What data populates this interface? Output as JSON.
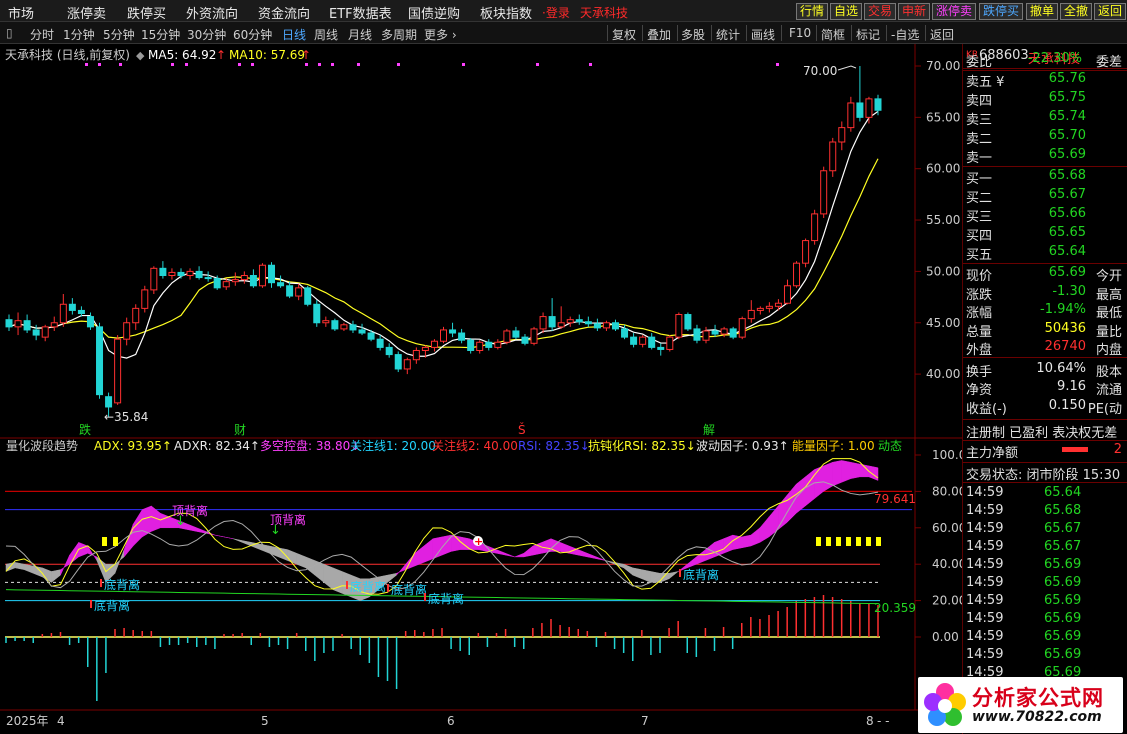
{
  "menu": {
    "items": [
      "市场",
      "涨停卖",
      "跌停买",
      "外资流向",
      "资金流向",
      "ETF数据表",
      "国债逆购",
      "板块指数"
    ],
    "login": "登录",
    "stock_name": "天承科技"
  },
  "right_buttons": [
    {
      "label": "行情",
      "color": "#ffff22"
    },
    {
      "label": "自选",
      "color": "#ffff22"
    },
    {
      "label": "交易",
      "color": "#ff3030"
    },
    {
      "label": "申新",
      "color": "#ff3030"
    },
    {
      "label": "涨停卖",
      "color": "#ff40ff"
    },
    {
      "label": "跌停买",
      "color": "#4ea8ff"
    },
    {
      "label": "撤单",
      "color": "#ffff22"
    },
    {
      "label": "全撤",
      "color": "#ffff22"
    },
    {
      "label": "返回",
      "color": "#ffff22"
    }
  ],
  "toolbar": {
    "periods": [
      "分时",
      "1分钟",
      "5分钟",
      "15分钟",
      "30分钟",
      "60分钟",
      "日线",
      "周线",
      "月线",
      "多周期",
      "更多 ›"
    ],
    "active": "日线",
    "right": [
      "复权",
      "叠加",
      "多股",
      "统计",
      "画线",
      "F10",
      "简框",
      "标记",
      "-自选",
      "返回"
    ]
  },
  "chart_header": {
    "name": "天承科技 (日线,前复权)",
    "ma5_label": "MA5: 64.92",
    "ma10_label": "MA10: 57.69",
    "up_arrow": "↑"
  },
  "main_axis": [
    "70.00",
    "65.00",
    "60.00",
    "55.00",
    "50.00",
    "45.00",
    "40.00"
  ],
  "annotations": {
    "high": "70.00",
    "low": "←35.84",
    "markers": [
      {
        "text": "跌",
        "color": "#22d522"
      },
      {
        "text": "财",
        "color": "#22d522"
      },
      {
        "text": "Š",
        "color": "#ff3030"
      },
      {
        "text": "解",
        "color": "#22d522"
      }
    ]
  },
  "indicator_header": [
    {
      "text": "量化波段趋势",
      "color": "#cccccc"
    },
    {
      "text": "ADX: 93.95↑",
      "color": "#ffff22"
    },
    {
      "text": "ADXR: 82.34↑",
      "color": "#e8e8e8"
    },
    {
      "text": "多空控盘: 38.80↓",
      "color": "#ff40ff"
    },
    {
      "text": "关注线1: 20.00",
      "color": "#22d5ff"
    },
    {
      "text": "关注线2: 40.00",
      "color": "#ff3030"
    },
    {
      "text": "RSI: 82.35↓",
      "color": "#4444ff"
    },
    {
      "text": "抗钝化RSI: 82.35↓",
      "color": "#ffff22"
    },
    {
      "text": "波动因子: 0.93↑",
      "color": "#e8e8e8"
    },
    {
      "text": "能量因子: 1.00",
      "color": "#ffcc00"
    },
    {
      "text": "动态",
      "color": "#22d522"
    }
  ],
  "indicator_axis": [
    "100.0",
    "80.00",
    "60.00",
    "40.00",
    "20.00",
    "0.00"
  ],
  "indicator_labels": {
    "top_div": "顶背离",
    "bottom_div": "底背离",
    "right_high": "79.641",
    "right_low": "20.359"
  },
  "date_axis": {
    "year": "2025年",
    "months": [
      "4",
      "5",
      "6",
      "7",
      "8"
    ],
    "end": "- -"
  },
  "quote": {
    "code_prefix": "KR",
    "code": "688603",
    "name": "天承科技",
    "weibi_label": "委比",
    "weibi": "-22.30%",
    "weicha_label": "委差",
    "sells": [
      {
        "label": "卖五 ¥",
        "price": "65.76"
      },
      {
        "label": "卖四",
        "price": "65.75"
      },
      {
        "label": "卖三",
        "price": "65.74"
      },
      {
        "label": "卖二",
        "price": "65.70"
      },
      {
        "label": "卖一",
        "price": "65.69"
      }
    ],
    "buys": [
      {
        "label": "买一",
        "price": "65.68"
      },
      {
        "label": "买二",
        "price": "65.67"
      },
      {
        "label": "买三",
        "price": "65.66"
      },
      {
        "label": "买四",
        "price": "65.65"
      },
      {
        "label": "买五",
        "price": "65.64"
      }
    ],
    "stats": [
      {
        "label": "现价",
        "value": "65.69",
        "color": "#22d522",
        "right": "今开"
      },
      {
        "label": "涨跌",
        "value": "-1.30",
        "color": "#22d522",
        "right": "最高"
      },
      {
        "label": "涨幅",
        "value": "-1.94%",
        "color": "#22d522",
        "right": "最低"
      },
      {
        "label": "总量",
        "value": "50436",
        "color": "#ffff22",
        "right": "量比"
      },
      {
        "label": "外盘",
        "value": "26740",
        "color": "#ff3030",
        "right": "内盘"
      },
      {
        "label": "换手",
        "value": "10.64%",
        "color": "#e8e8e8",
        "right": "股本"
      },
      {
        "label": "净资",
        "value": "9.16",
        "color": "#e8e8e8",
        "right": "流通"
      },
      {
        "label": "收益(-)",
        "value": "0.150",
        "color": "#e8e8e8",
        "right": "PE(动"
      }
    ],
    "reg_line": "注册制 已盈利 表决权无差",
    "capital_label": "主力净额",
    "capital_value": "2",
    "trade_status": "交易状态: 闭市阶段 15:30",
    "ticks": [
      {
        "time": "14:59",
        "price": "65.64"
      },
      {
        "time": "14:59",
        "price": "65.68"
      },
      {
        "time": "14:59",
        "price": "65.67"
      },
      {
        "time": "14:59",
        "price": "65.67"
      },
      {
        "time": "14:59",
        "price": "65.69"
      },
      {
        "time": "14:59",
        "price": "65.69"
      },
      {
        "time": "14:59",
        "price": "65.69"
      },
      {
        "time": "14:59",
        "price": "65.69"
      },
      {
        "time": "14:59",
        "price": "65.69"
      },
      {
        "time": "14:59",
        "price": "65.69"
      },
      {
        "time": "14:59",
        "price": "65.69"
      },
      {
        "time": "14:59",
        "price": "65.69"
      }
    ]
  },
  "logo": {
    "title": "分析家公式网",
    "url": "www.70822.com"
  },
  "colors": {
    "up": "#ff3030",
    "down": "#22d5d5",
    "ma5": "#ffffff",
    "ma10": "#ffff22",
    "magenta": "#ff40ff"
  },
  "candles": [
    [
      45.3,
      45.8,
      44.2,
      44.6
    ],
    [
      44.6,
      46.0,
      43.8,
      45.2
    ],
    [
      45.2,
      45.8,
      44.0,
      44.3
    ],
    [
      44.3,
      44.8,
      43.3,
      43.8
    ],
    [
      43.6,
      44.8,
      43.2,
      44.6
    ],
    [
      44.6,
      45.6,
      44.2,
      45.0
    ],
    [
      45.0,
      47.8,
      44.6,
      46.8
    ],
    [
      46.8,
      47.4,
      45.8,
      46.2
    ],
    [
      46.2,
      46.6,
      45.6,
      45.9
    ],
    [
      45.6,
      46.0,
      44.3,
      44.6
    ],
    [
      44.6,
      45.0,
      37.6,
      38.0
    ],
    [
      37.8,
      38.2,
      35.84,
      36.8
    ],
    [
      37.2,
      43.8,
      37.0,
      43.4
    ],
    [
      43.4,
      45.5,
      42.8,
      45.0
    ],
    [
      45.0,
      46.8,
      44.3,
      46.4
    ],
    [
      46.4,
      48.6,
      46.0,
      48.2
    ],
    [
      48.2,
      50.5,
      47.8,
      50.3
    ],
    [
      50.3,
      51.0,
      49.3,
      49.6
    ],
    [
      49.6,
      50.3,
      49.2,
      49.9
    ],
    [
      49.9,
      50.3,
      49.3,
      49.6
    ],
    [
      49.6,
      50.3,
      49.2,
      50.0
    ],
    [
      50.0,
      50.5,
      49.2,
      49.4
    ],
    [
      49.4,
      50.0,
      49.0,
      49.3
    ],
    [
      49.3,
      49.6,
      48.2,
      48.4
    ],
    [
      48.5,
      49.3,
      48.2,
      49.0
    ],
    [
      49.0,
      49.9,
      48.6,
      49.2
    ],
    [
      49.2,
      50.0,
      48.8,
      49.6
    ],
    [
      49.6,
      50.2,
      48.4,
      48.6
    ],
    [
      48.6,
      50.8,
      48.4,
      50.6
    ],
    [
      50.6,
      50.9,
      48.4,
      48.9
    ],
    [
      48.9,
      49.6,
      48.4,
      48.6
    ],
    [
      48.6,
      49.0,
      47.4,
      47.6
    ],
    [
      47.6,
      48.8,
      47.2,
      48.4
    ],
    [
      48.4,
      48.6,
      46.6,
      46.8
    ],
    [
      46.8,
      47.2,
      44.6,
      45.0
    ],
    [
      45.0,
      45.6,
      44.6,
      45.2
    ],
    [
      45.2,
      45.4,
      44.2,
      44.4
    ],
    [
      44.4,
      45.0,
      44.2,
      44.8
    ],
    [
      44.8,
      45.2,
      44.0,
      44.3
    ],
    [
      44.3,
      44.9,
      43.8,
      44.0
    ],
    [
      44.0,
      44.3,
      43.2,
      43.4
    ],
    [
      43.4,
      43.8,
      42.3,
      42.6
    ],
    [
      42.6,
      43.0,
      41.6,
      41.9
    ],
    [
      41.9,
      42.2,
      40.2,
      40.5
    ],
    [
      40.5,
      41.6,
      40.0,
      41.4
    ],
    [
      41.4,
      42.6,
      41.0,
      42.3
    ],
    [
      42.3,
      42.8,
      41.6,
      42.6
    ],
    [
      42.6,
      43.4,
      42.2,
      43.2
    ],
    [
      43.2,
      44.6,
      43.0,
      44.3
    ],
    [
      44.3,
      45.0,
      43.6,
      44.0
    ],
    [
      44.0,
      44.4,
      43.0,
      43.3
    ],
    [
      43.3,
      43.5,
      42.0,
      42.3
    ],
    [
      42.3,
      43.3,
      42.0,
      43.1
    ],
    [
      43.1,
      43.4,
      42.3,
      42.6
    ],
    [
      42.6,
      43.4,
      42.4,
      43.1
    ],
    [
      43.1,
      44.4,
      42.9,
      44.2
    ],
    [
      44.2,
      44.6,
      43.4,
      43.6
    ],
    [
      43.6,
      43.9,
      42.8,
      43.0
    ],
    [
      43.0,
      44.6,
      42.8,
      44.4
    ],
    [
      44.4,
      46.0,
      44.0,
      45.6
    ],
    [
      45.6,
      47.4,
      44.2,
      44.6
    ],
    [
      44.6,
      46.6,
      44.4,
      45.0
    ],
    [
      45.0,
      45.6,
      44.6,
      45.3
    ],
    [
      45.3,
      45.8,
      44.8,
      45.1
    ],
    [
      45.1,
      45.6,
      44.6,
      44.9
    ],
    [
      44.9,
      45.4,
      44.2,
      44.5
    ],
    [
      44.5,
      45.2,
      44.2,
      45.0
    ],
    [
      45.0,
      45.3,
      44.2,
      44.4
    ],
    [
      44.4,
      44.8,
      43.4,
      43.6
    ],
    [
      43.6,
      44.0,
      42.6,
      42.9
    ],
    [
      42.9,
      43.8,
      42.6,
      43.6
    ],
    [
      43.6,
      44.0,
      42.4,
      42.6
    ],
    [
      42.6,
      43.0,
      41.8,
      42.4
    ],
    [
      42.4,
      43.8,
      42.2,
      43.6
    ],
    [
      43.6,
      46.0,
      43.4,
      45.8
    ],
    [
      45.8,
      46.0,
      44.2,
      44.4
    ],
    [
      44.4,
      44.8,
      43.0,
      43.3
    ],
    [
      43.3,
      44.6,
      43.0,
      44.2
    ],
    [
      44.2,
      44.8,
      43.6,
      43.9
    ],
    [
      43.9,
      44.6,
      43.6,
      44.4
    ],
    [
      44.4,
      44.6,
      43.4,
      43.6
    ],
    [
      43.6,
      45.6,
      43.4,
      45.4
    ],
    [
      45.4,
      47.2,
      45.0,
      46.2
    ],
    [
      46.2,
      46.6,
      45.8,
      46.4
    ],
    [
      46.4,
      47.0,
      46.0,
      46.6
    ],
    [
      46.6,
      47.3,
      46.2,
      46.9
    ],
    [
      46.9,
      49.2,
      46.8,
      48.6
    ],
    [
      48.6,
      51.0,
      48.4,
      50.8
    ],
    [
      50.8,
      53.2,
      50.4,
      53.0
    ],
    [
      53.0,
      56.0,
      52.6,
      55.6
    ],
    [
      55.6,
      60.2,
      55.2,
      59.8
    ],
    [
      59.8,
      63.0,
      59.2,
      62.6
    ],
    [
      62.6,
      64.6,
      61.8,
      64.0
    ],
    [
      64.0,
      67.0,
      63.6,
      66.4
    ],
    [
      66.4,
      70.0,
      64.6,
      65.0
    ],
    [
      65.0,
      67.0,
      64.4,
      66.8
    ],
    [
      66.8,
      67.2,
      65.2,
      65.69
    ]
  ],
  "volumes": [
    -3,
    -2,
    -2,
    -3,
    3,
    4,
    5,
    -4,
    -3,
    -15,
    -32,
    -18,
    8,
    9,
    7,
    6,
    6,
    -5,
    -4,
    -4,
    -3,
    -5,
    -4,
    -6,
    3,
    3,
    4,
    -4,
    4,
    -5,
    -4,
    -6,
    4,
    -7,
    -12,
    -8,
    -7,
    3,
    -6,
    -9,
    -13,
    -20,
    -22,
    -26,
    6,
    7,
    5,
    8,
    9,
    -6,
    -7,
    -9,
    4,
    -5,
    4,
    8,
    -5,
    -6,
    9,
    14,
    18,
    12,
    10,
    8,
    6,
    -5,
    5,
    -6,
    -8,
    -12,
    7,
    -9,
    -8,
    9,
    16,
    -8,
    -10,
    9,
    -7,
    10,
    -6,
    14,
    20,
    18,
    22,
    26,
    30,
    36,
    38,
    40,
    42,
    40,
    38,
    36,
    34,
    33,
    32
  ],
  "ind_white": [
    36,
    38,
    37,
    35,
    33,
    30,
    34,
    45,
    52,
    50,
    42,
    30,
    35,
    48,
    62,
    70,
    72,
    68,
    66,
    64,
    62,
    60,
    58,
    56,
    55,
    54,
    52,
    50,
    48,
    46,
    44,
    42,
    40,
    38,
    34,
    30,
    26,
    24,
    22,
    20,
    22,
    26,
    30,
    34,
    40,
    46,
    50,
    54,
    55,
    56,
    55,
    54,
    52,
    50,
    48,
    46,
    44,
    46,
    50,
    52,
    54,
    52,
    50,
    48,
    46,
    44,
    42,
    40,
    38,
    34,
    32,
    30,
    30,
    32,
    36,
    40,
    44,
    48,
    52,
    54,
    56,
    55,
    56,
    60,
    66,
    72,
    78,
    84,
    88,
    92,
    94,
    96,
    97,
    96,
    95,
    94,
    93
  ],
  "ind_yellow": [
    40,
    41,
    40,
    39,
    38,
    36,
    37,
    40,
    44,
    46,
    44,
    40,
    40,
    44,
    50,
    55,
    58,
    60,
    60,
    60,
    59,
    58,
    57,
    56,
    55,
    54,
    53,
    52,
    51,
    50,
    49,
    48,
    46,
    44,
    42,
    40,
    38,
    36,
    34,
    32,
    32,
    33,
    34,
    35,
    37,
    39,
    41,
    43,
    45,
    47,
    48,
    48,
    48,
    47,
    46,
    45,
    44,
    44,
    45,
    46,
    47,
    47,
    46,
    45,
    44,
    43,
    42,
    41,
    40,
    38,
    37,
    36,
    35,
    35,
    36,
    38,
    40,
    42,
    44,
    46,
    48,
    49,
    50,
    52,
    55,
    59,
    63,
    68,
    72,
    76,
    80,
    83,
    85,
    87,
    88,
    88,
    86
  ]
}
